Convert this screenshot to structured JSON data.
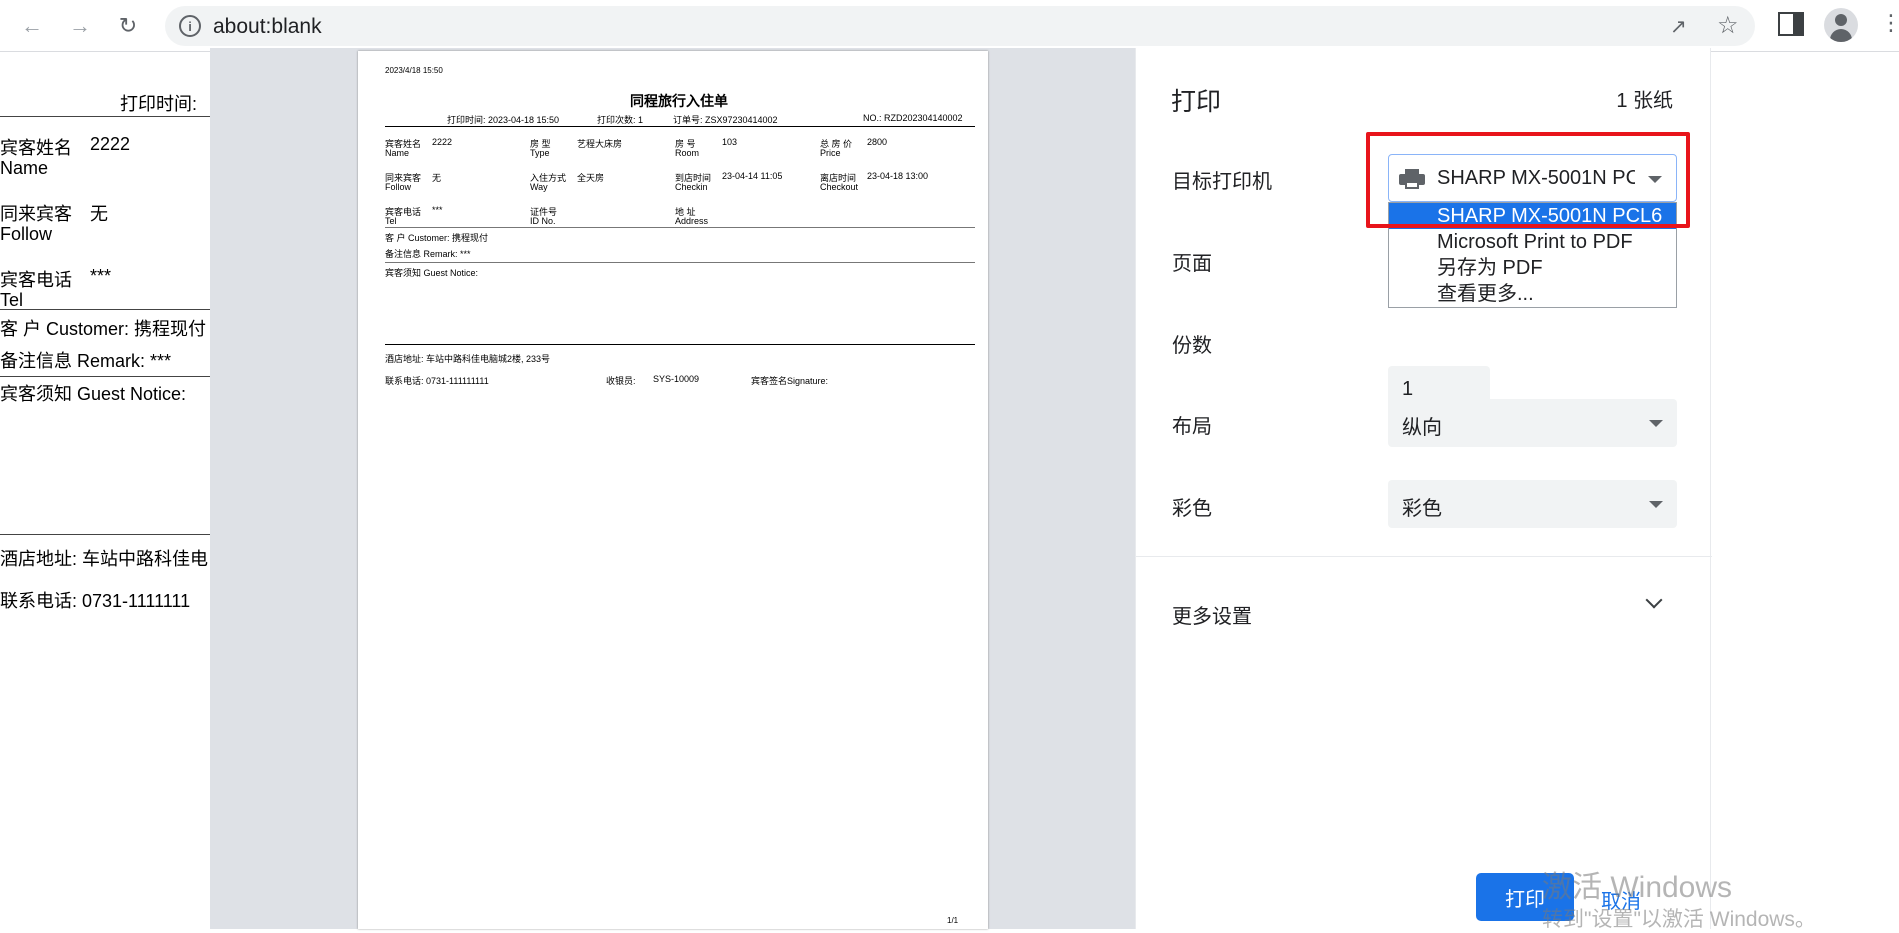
{
  "browser": {
    "url": "about:blank",
    "icons": {
      "back": "arrow-left-icon",
      "forward": "arrow-right-icon",
      "reload": "reload-icon",
      "info": "info-icon",
      "share": "share-icon",
      "bookmark": "star-icon",
      "side_panel": "side-panel-icon",
      "profile": "avatar-icon",
      "menu": "more-vert-icon"
    }
  },
  "background_page": {
    "print_time_label": "打印时间:",
    "guest_name_cn": "宾客姓名",
    "guest_name_val": "2222",
    "guest_name_en": "Name",
    "follow_cn": "同来宾客",
    "follow_val": "无",
    "follow_en": "Follow",
    "tel_cn": "宾客电话",
    "tel_val": "***",
    "tel_en": "Tel",
    "customer": "客 户 Customer: 携程现付",
    "remark": "备注信息 Remark: ***",
    "notice": "宾客须知 Guest Notice:",
    "hotel_addr": "酒店地址:   车站中路科佳电",
    "phone": "联系电话:   0731-1111111"
  },
  "preview": {
    "timestamp": "2023/4/18 15:50",
    "title": "同程旅行入住单",
    "print_time": "打印时间:  2023-04-18 15:50",
    "print_count": "打印次数:  1",
    "order_no": "订单号:   ZSX97230414002",
    "no": "NO.:  RZD202304140002",
    "rows": [
      {
        "c1_cn": "宾客姓名",
        "c1_en": "Name",
        "c1_val": "2222",
        "c2_cn": "房  型",
        "c2_en": "Type",
        "c2_val": "艺程大床房",
        "c3_cn": "房  号",
        "c3_en": "Room",
        "c3_val": "103",
        "c4_cn": "总 房 价",
        "c4_en": "Price",
        "c4_val": "2800"
      },
      {
        "c1_cn": "同来宾客",
        "c1_en": "Follow",
        "c1_val": "无",
        "c2_cn": "入住方式",
        "c2_en": "Way",
        "c2_val": "全天房",
        "c3_cn": "到店时间",
        "c3_en": "Checkin",
        "c3_val": "23-04-14 11:05",
        "c4_cn": "离店时间",
        "c4_en": "Checkout",
        "c4_val": "23-04-18 13:00"
      },
      {
        "c1_cn": "宾客电话",
        "c1_en": "Tel",
        "c1_val": "***",
        "c2_cn": "证件号",
        "c2_en": "ID No.",
        "c2_val": "",
        "c3_cn": "地  址",
        "c3_en": "Address",
        "c3_val": "",
        "c4_cn": "",
        "c4_en": "",
        "c4_val": ""
      }
    ],
    "customer": "客 户 Customer: 携程现付",
    "remark": "备注信息 Remark: ***",
    "notice": "宾客须知 Guest Notice:",
    "hotel_addr": "酒店地址:   车站中路科佳电脑城2楼, 233号",
    "phone": "联系电话:   0731-111111111",
    "cashier_label": "收银员:",
    "cashier_val": "SYS-10009",
    "signature": "宾客签名Signature:",
    "page_num": "1/1"
  },
  "settings": {
    "title": "打印",
    "sheets": "1 张纸",
    "destination_label": "目标打印机",
    "destination_value": "SHARP MX-5001N PCL6",
    "destination_options": [
      "SHARP MX-5001N PCL6",
      "Microsoft Print to PDF",
      "另存为 PDF",
      "查看更多..."
    ],
    "pages_label": "页面",
    "copies_label": "份数",
    "copies_value": "1",
    "layout_label": "布局",
    "layout_value": "纵向",
    "color_label": "彩色",
    "color_value": "彩色",
    "more_settings": "更多设置",
    "print_button": "打印",
    "cancel_button": "取消",
    "highlight_color": "#e8141b",
    "accent_color": "#1a73e8"
  },
  "watermark": {
    "line1": "激活 Windows",
    "line2": "转到\"设置\"以激活 Windows。"
  }
}
